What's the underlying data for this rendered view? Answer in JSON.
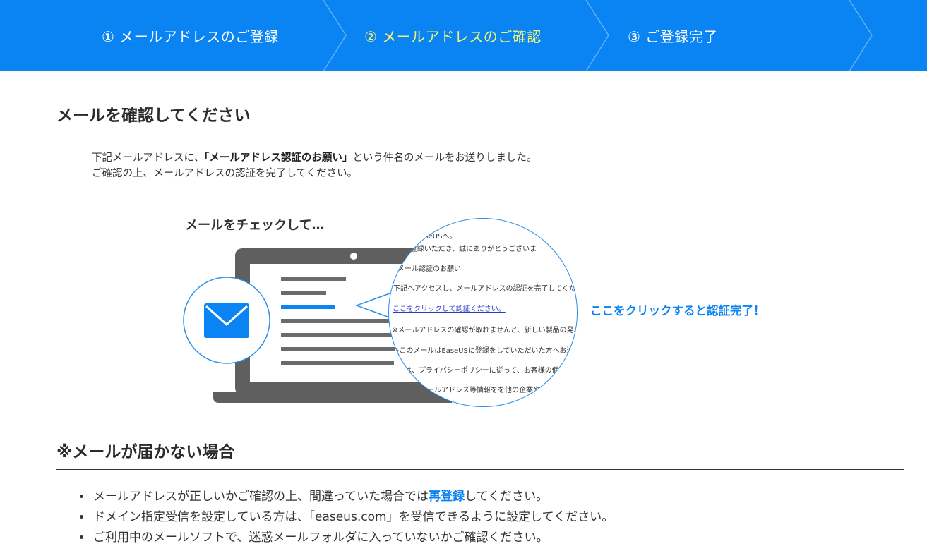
{
  "steps": [
    {
      "label": "① メールアドレスのご登録",
      "active": false
    },
    {
      "label": "② メールアドレスのご確認",
      "active": true
    },
    {
      "label": "③ ご登録完了",
      "active": false
    }
  ],
  "section1": {
    "title": "メールを確認してください",
    "intro_line1_before": "下記メールアドレスに、",
    "intro_line1_bold": "「メールアドレス認証のお願い」",
    "intro_line1_after": "という件名のメールをお送りしました。",
    "intro_line2": "ご確認の上、メールアドレスの認証を完了してください。"
  },
  "illustration": {
    "check_label": "メールをチェックして…",
    "cta": "ここをクリックすると認証完了！",
    "email_lines": [
      "EaseUSへ。",
      "にご登録いただき、誠にありがとうございま",
      "メール認証のお願い",
      "下記へアクセスし、メールアドレスの認証を完了してくださ",
      "ここをクリックして認証ください。",
      "※メールアドレスの確認が取れませんと、新しい製品の発表",
      "※このメールはEaseUSに登録をしていただいた方へお送り",
      "は、プライバシーポリシーに従って、お客様の個人",
      "メールアドレス等情報をを他の企業や組"
    ]
  },
  "section2": {
    "title": "※メールが届かない場合",
    "bullet1_before": "メールアドレスが正しいかご確認の上、間違っていた場合では",
    "bullet1_link": "再登録",
    "bullet1_after": "してください。",
    "bullet2": "ドメイン指定受信を設定している方は、「easeus.com」を受信できるように設定してください。",
    "bullet3": "ご利用中のメールソフトで、迷惑メールフォルダに入っていないかご確認ください。"
  },
  "colors": {
    "brand_blue": "#0a84f2",
    "active_step": "#f3f37a",
    "laptop_gray": "#5f5f5f"
  }
}
